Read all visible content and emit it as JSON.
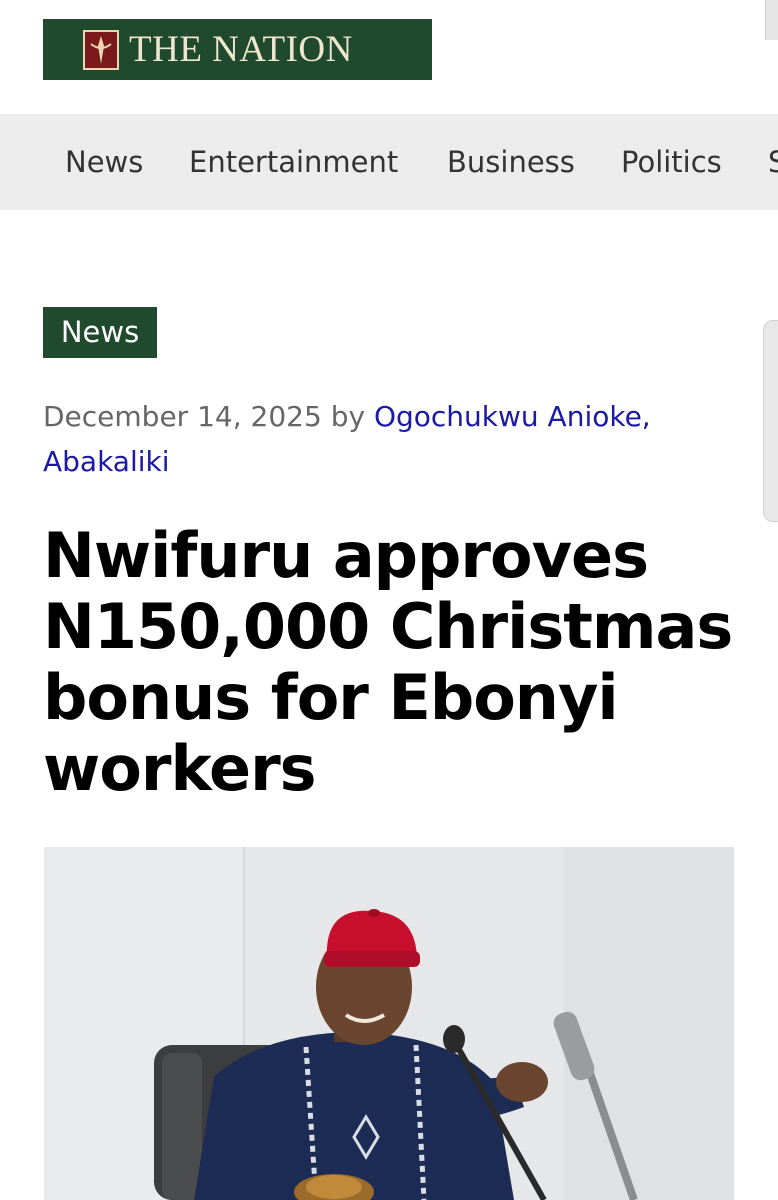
{
  "brand": {
    "name": "THE NATION",
    "bg_color": "#1f4a2e",
    "text_color": "#efe6cf",
    "emblem_color": "#7a1a1a"
  },
  "nav": {
    "items": [
      "News",
      "Entertainment",
      "Business",
      "Politics",
      "S"
    ]
  },
  "article": {
    "category": "News",
    "date": "December 14, 2025",
    "by": "by",
    "author_line1": "Ogochukwu Anioke,",
    "author_line2": "Abakaliki",
    "title": "Nwifuru approves N150,000 Christmas bonus for Ebonyi workers"
  },
  "colors": {
    "accent": "#1f4a2e",
    "link": "#1a1aa6",
    "nav_bg": "#ececec",
    "cap_red": "#c8102e",
    "attire_navy": "#1d2c55"
  }
}
